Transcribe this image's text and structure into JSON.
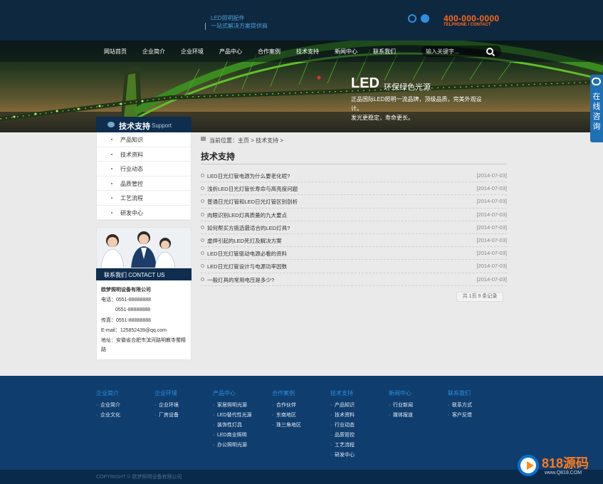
{
  "header": {
    "slogan_line1": "LED照明配件",
    "slogan_line2": "一站式解决方案提供商",
    "phone": "400-000-0000",
    "phone_sub": "TELPHONE / CONTACT"
  },
  "nav": {
    "items": [
      "网站首页",
      "企业简介",
      "企业环境",
      "产品中心",
      "合作案例",
      "技术支持",
      "新闻中心",
      "联系我们"
    ],
    "search_placeholder": "输入关键字..."
  },
  "banner": {
    "title": "LED",
    "title2": "环保绿色光源",
    "desc_line1": "正品国际LED照明一流品牌，顶级品质，完美外观设计。",
    "desc_line2": "发光更稳定，寿命更长。"
  },
  "consult": {
    "label": "在线咨询"
  },
  "sidebar": {
    "title": "技术支持",
    "title_en": "Support",
    "items": [
      "产品知识",
      "技术资料",
      "行业动态",
      "品质管控",
      "工艺流程",
      "研发中心"
    ]
  },
  "contact": {
    "title": "联系我们 CONTACT US",
    "company": "欧梦照明设备有限公司",
    "tel1": "电话：0551-88888888",
    "tel2": "0551-88888888",
    "fax": "传真：0551-88888888",
    "email": "E-mail：125852439@qq.com",
    "address": "地址：安徽省合肥市滨河路明教寺蜀精路"
  },
  "main": {
    "breadcrumb": "当前位置：主页 > 技术支持 >",
    "title": "技术支持",
    "articles": [
      {
        "title": "LED日光灯管电源为什么要老化呢?",
        "date": "[2014-07-03]"
      },
      {
        "title": "浅析LED日光灯管长寿命与高亮度问题",
        "date": "[2014-07-03]"
      },
      {
        "title": "普通日光灯管和LED日光灯管区别剖析",
        "date": "[2014-07-03]"
      },
      {
        "title": "肉眼识别LED灯具质量的九大要点",
        "date": "[2014-07-03]"
      },
      {
        "title": "如何帮买方挑选最适合的LED灯具?",
        "date": "[2014-07-03]"
      },
      {
        "title": "虚焊引起的LED死灯及解决方案",
        "date": "[2014-07-03]"
      },
      {
        "title": "LED日光灯管驱动电源必看的资料",
        "date": "[2014-07-03]"
      },
      {
        "title": "LED日光灯管设计与电源功率因数",
        "date": "[2014-07-03]"
      },
      {
        "title": "一般灯具的常用电压是多少?",
        "date": "[2014-07-03]"
      }
    ],
    "pager": "共 1页 9 条记录"
  },
  "footer": {
    "columns": [
      {
        "head": "企业简介",
        "items": [
          "企业简介",
          "企业文化"
        ]
      },
      {
        "head": "企业环境",
        "items": [
          "企业环境",
          "厂房设备"
        ]
      },
      {
        "head": "产品中心",
        "items": [
          "家居照明光源",
          "LED替代性光源",
          "装饰性灯具",
          "LED商业照明",
          "办公照明光源"
        ]
      },
      {
        "head": "合作案例",
        "items": [
          "合作伙伴",
          "东南地区",
          "珠三角地区"
        ]
      },
      {
        "head": "技术支持",
        "items": [
          "产品知识",
          "技术资料",
          "行业动态",
          "品质管控",
          "工艺流程",
          "研发中心"
        ]
      },
      {
        "head": "新闻中心",
        "items": [
          "行业新闻",
          "媒体报道"
        ]
      },
      {
        "head": "联系我们",
        "items": [
          "联系方式",
          "客户反馈"
        ]
      }
    ],
    "copyright": "COPYRIGHT © 欧梦照明设备有限公司"
  },
  "watermark": {
    "name": "818源码",
    "url": "www.Q818.COM"
  }
}
